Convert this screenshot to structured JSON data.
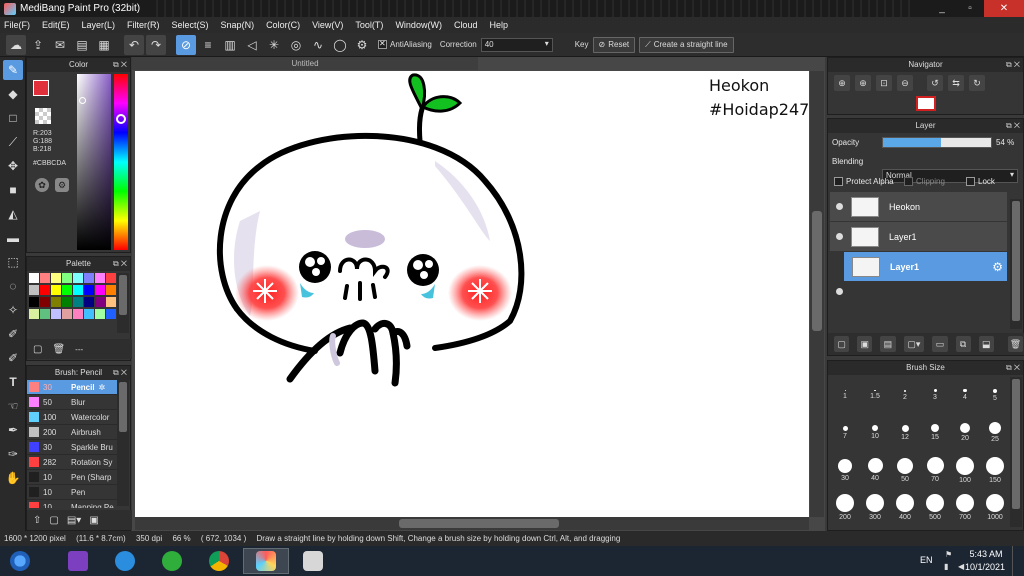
{
  "window": {
    "title": "MediBang Paint Pro (32bit)",
    "minimize": "_",
    "maximize": "▫",
    "close": "✕"
  },
  "menu": [
    "File(F)",
    "Edit(E)",
    "Layer(L)",
    "Filter(R)",
    "Select(S)",
    "Snap(N)",
    "Color(C)",
    "View(V)",
    "Tool(T)",
    "Window(W)",
    "Cloud",
    "Help"
  ],
  "toolbar": {
    "antialiasing_label": "AntiAliasing",
    "correction_label": "Correction",
    "correction_value": "40",
    "key_label": "Key",
    "reset_label": "Reset",
    "straight_line_label": "Create a straight line"
  },
  "color_panel": {
    "title": "Color",
    "rgb": [
      "R:203",
      "G:188",
      "B:218"
    ],
    "hex": "#CBBCDA",
    "fg_color": "#e0303c",
    "current_color": "#CBBCDA"
  },
  "palette_panel": {
    "title": "Palette",
    "colors": [
      "#ffffff",
      "#ff8080",
      "#ffff80",
      "#80ff80",
      "#80ffff",
      "#8080ff",
      "#ff80ff",
      "#ff4040",
      "#c0c0c0",
      "#ff0000",
      "#ffff00",
      "#00ff00",
      "#00ffff",
      "#0000ff",
      "#ff00ff",
      "#ff8000",
      "#000000",
      "#800000",
      "#808000",
      "#008000",
      "#008080",
      "#000080",
      "#800080",
      "#ffc080",
      "#d8f0a0",
      "#60c080",
      "#c0c0ff",
      "#e0a0a0",
      "#ff80c0",
      "#40c0ff",
      "#a0ffa0",
      "#2060ff"
    ],
    "more_label": "---"
  },
  "brush_panel": {
    "title": "Brush: Pencil",
    "items": [
      {
        "size": "30",
        "name": "Pencil",
        "color": "#ff8080",
        "selected": true
      },
      {
        "size": "50",
        "name": "Blur",
        "color": "#ff80ff"
      },
      {
        "size": "100",
        "name": "Watercolor",
        "color": "#60d0ff"
      },
      {
        "size": "200",
        "name": "Airbrush",
        "color": "#c0c0c0"
      },
      {
        "size": "30",
        "name": "Sparkle Bru",
        "color": "#4040ff"
      },
      {
        "size": "282",
        "name": "Rotation Sy",
        "color": "#ff4040"
      },
      {
        "size": "10",
        "name": "Pen (Sharp",
        "color": "#202020"
      },
      {
        "size": "10",
        "name": "Pen",
        "color": "#202020"
      },
      {
        "size": "10",
        "name": "Mapping Pe",
        "color": "#ff4040"
      }
    ]
  },
  "document": {
    "tab_title": "Untitled"
  },
  "canvas_text": {
    "line1": "Heokon",
    "line2": "#Hoidap247"
  },
  "navigator": {
    "title": "Navigator"
  },
  "layer_panel": {
    "title": "Layer",
    "opacity_label": "Opacity",
    "opacity_value": "54 %",
    "opacity_fraction": 0.54,
    "blending_label": "Blending",
    "blending_value": "Normal",
    "protect_alpha": "Protect Alpha",
    "clipping": "Clipping",
    "lock": "Lock",
    "layers": [
      {
        "name": "Heokon"
      },
      {
        "name": "Layer1"
      },
      {
        "name": "Layer1",
        "selected": true
      }
    ]
  },
  "brush_size_panel": {
    "title": "Brush Size",
    "sizes": [
      "1",
      "1.5",
      "2",
      "3",
      "4",
      "5",
      "7",
      "10",
      "12",
      "15",
      "20",
      "25",
      "30",
      "40",
      "50",
      "70",
      "100",
      "150",
      "200",
      "300",
      "400",
      "500",
      "700",
      "1000"
    ]
  },
  "status": {
    "pixel_size": "1600 * 1200 pixel",
    "cm_size": "(11.6 * 8.7cm)",
    "dpi": "350 dpi",
    "zoom": "66 %",
    "coords": "( 672, 1034 )",
    "hint": "Draw a straight line by holding down Shift, Change a brush size by holding down Ctrl, Alt, and dragging"
  },
  "taskbar": {
    "lang": "EN",
    "time": "5:43 AM",
    "date": "10/1/2021"
  }
}
